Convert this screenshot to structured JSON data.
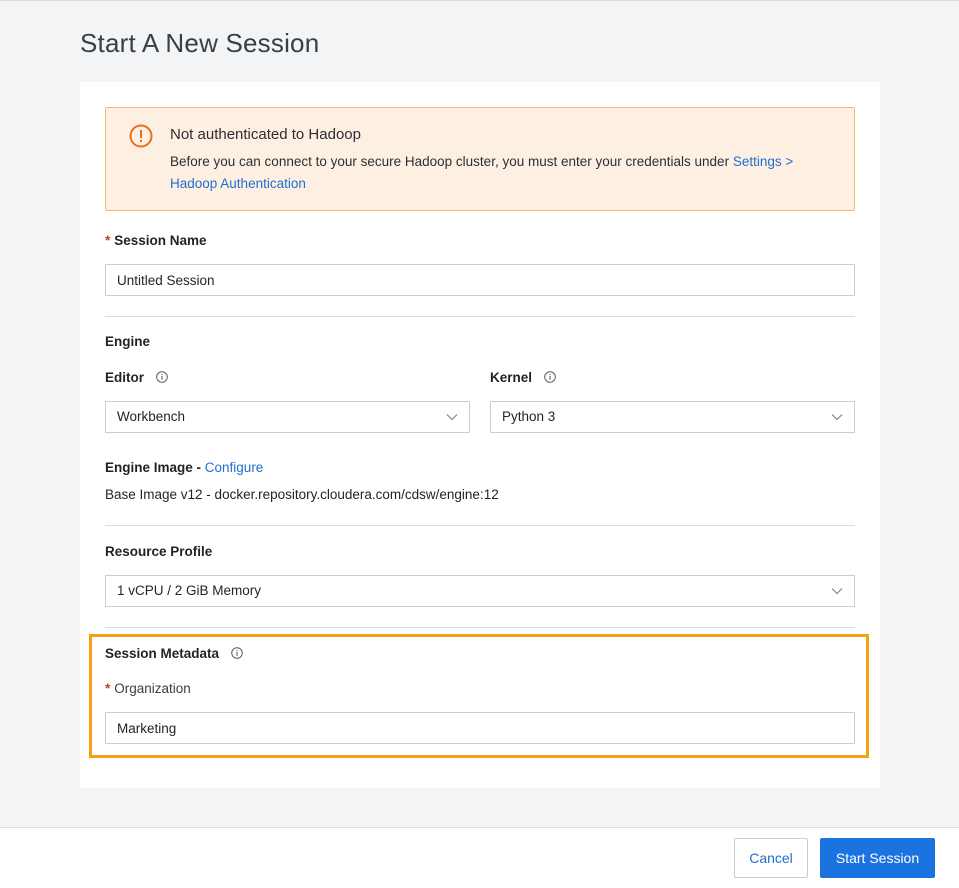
{
  "page": {
    "title": "Start A New Session"
  },
  "alert": {
    "title": "Not authenticated to Hadoop",
    "body_prefix": "Before you can connect to your secure Hadoop cluster, you must enter your credentials under ",
    "link_label": "Settings > Hadoop Authentication",
    "icon": "warning-circle-icon",
    "color": "#e8701a"
  },
  "session_name": {
    "required_mark": "*",
    "label": "Session Name",
    "value": "Untitled Session"
  },
  "engine": {
    "heading": "Engine",
    "editor": {
      "label": "Editor",
      "value": "Workbench"
    },
    "kernel": {
      "label": "Kernel",
      "value": "Python 3"
    },
    "image": {
      "label": "Engine Image - ",
      "configure_link": "Configure",
      "value": "Base Image v12 - docker.repository.cloudera.com/cdsw/engine:12"
    }
  },
  "resource_profile": {
    "label": "Resource Profile",
    "value": "1 vCPU / 2 GiB Memory"
  },
  "metadata": {
    "heading": "Session Metadata",
    "organization": {
      "required_mark": "*",
      "label": "Organization",
      "value": "Marketing"
    }
  },
  "footer": {
    "cancel_label": "Cancel",
    "start_label": "Start Session"
  },
  "colors": {
    "accent": "#1a73e0",
    "highlight": "#f5a10f",
    "alert_bg": "#fdf0e2"
  }
}
